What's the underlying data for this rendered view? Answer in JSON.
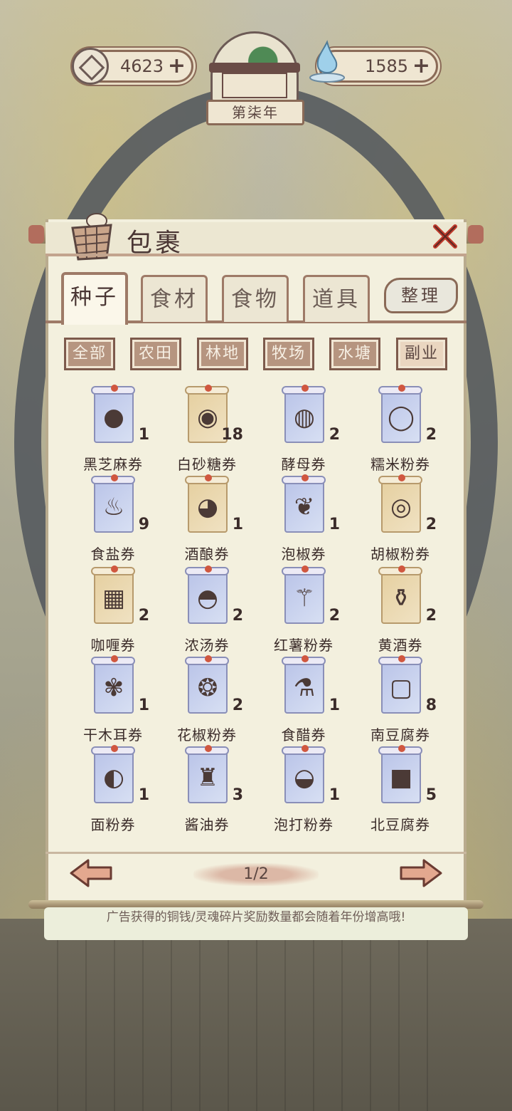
{
  "hud": {
    "coins": "4623",
    "spirit": "1585",
    "year": "第柒年"
  },
  "panel": {
    "title": "包裹",
    "tabs": [
      {
        "label": "种子",
        "active": true
      },
      {
        "label": "食材",
        "active": false
      },
      {
        "label": "食物",
        "active": false
      },
      {
        "label": "道具",
        "active": false
      }
    ],
    "sort_label": "整理",
    "filters": [
      {
        "label": "全部",
        "selected": false
      },
      {
        "label": "农田",
        "selected": false
      },
      {
        "label": "林地",
        "selected": false
      },
      {
        "label": "牧场",
        "selected": false
      },
      {
        "label": "水塘",
        "selected": false
      },
      {
        "label": "副业",
        "selected": true
      }
    ],
    "items": [
      {
        "name": "黑芝麻券",
        "count": "1",
        "icon": "black-sesame-bowl-icon"
      },
      {
        "name": "白砂糖券",
        "count": "18",
        "icon": "white-sugar-jar-icon"
      },
      {
        "name": "酵母券",
        "count": "2",
        "icon": "yeast-jar-icon"
      },
      {
        "name": "糯米粉券",
        "count": "2",
        "icon": "glutinous-rice-flour-plate-icon"
      },
      {
        "name": "食盐券",
        "count": "9",
        "icon": "salt-pot-icon"
      },
      {
        "name": "酒酿券",
        "count": "1",
        "icon": "rice-wine-crock-icon"
      },
      {
        "name": "泡椒券",
        "count": "1",
        "icon": "pickled-pepper-icon"
      },
      {
        "name": "胡椒粉券",
        "count": "2",
        "icon": "pepper-powder-basket-icon"
      },
      {
        "name": "咖喱券",
        "count": "2",
        "icon": "curry-blocks-icon"
      },
      {
        "name": "浓汤券",
        "count": "2",
        "icon": "soup-pot-icon"
      },
      {
        "name": "红薯粉券",
        "count": "2",
        "icon": "sweet-potato-starch-icon"
      },
      {
        "name": "黄酒券",
        "count": "2",
        "icon": "yellow-wine-jar-icon"
      },
      {
        "name": "干木耳券",
        "count": "1",
        "icon": "dried-fungus-icon"
      },
      {
        "name": "花椒粉券",
        "count": "2",
        "icon": "sichuan-pepper-powder-icon"
      },
      {
        "name": "食醋券",
        "count": "1",
        "icon": "vinegar-bottle-icon"
      },
      {
        "name": "南豆腐券",
        "count": "8",
        "icon": "soft-tofu-icon"
      },
      {
        "name": "面粉券",
        "count": "1",
        "icon": "flour-bowl-icon"
      },
      {
        "name": "酱油券",
        "count": "3",
        "icon": "soy-sauce-bottle-icon"
      },
      {
        "name": "泡打粉券",
        "count": "1",
        "icon": "baking-powder-icon"
      },
      {
        "name": "北豆腐券",
        "count": "5",
        "icon": "firm-tofu-icon"
      }
    ],
    "page": "1/2",
    "tip": "广告获得的铜钱/灵魂碎片奖励数量都会随着年份增高哦!"
  }
}
